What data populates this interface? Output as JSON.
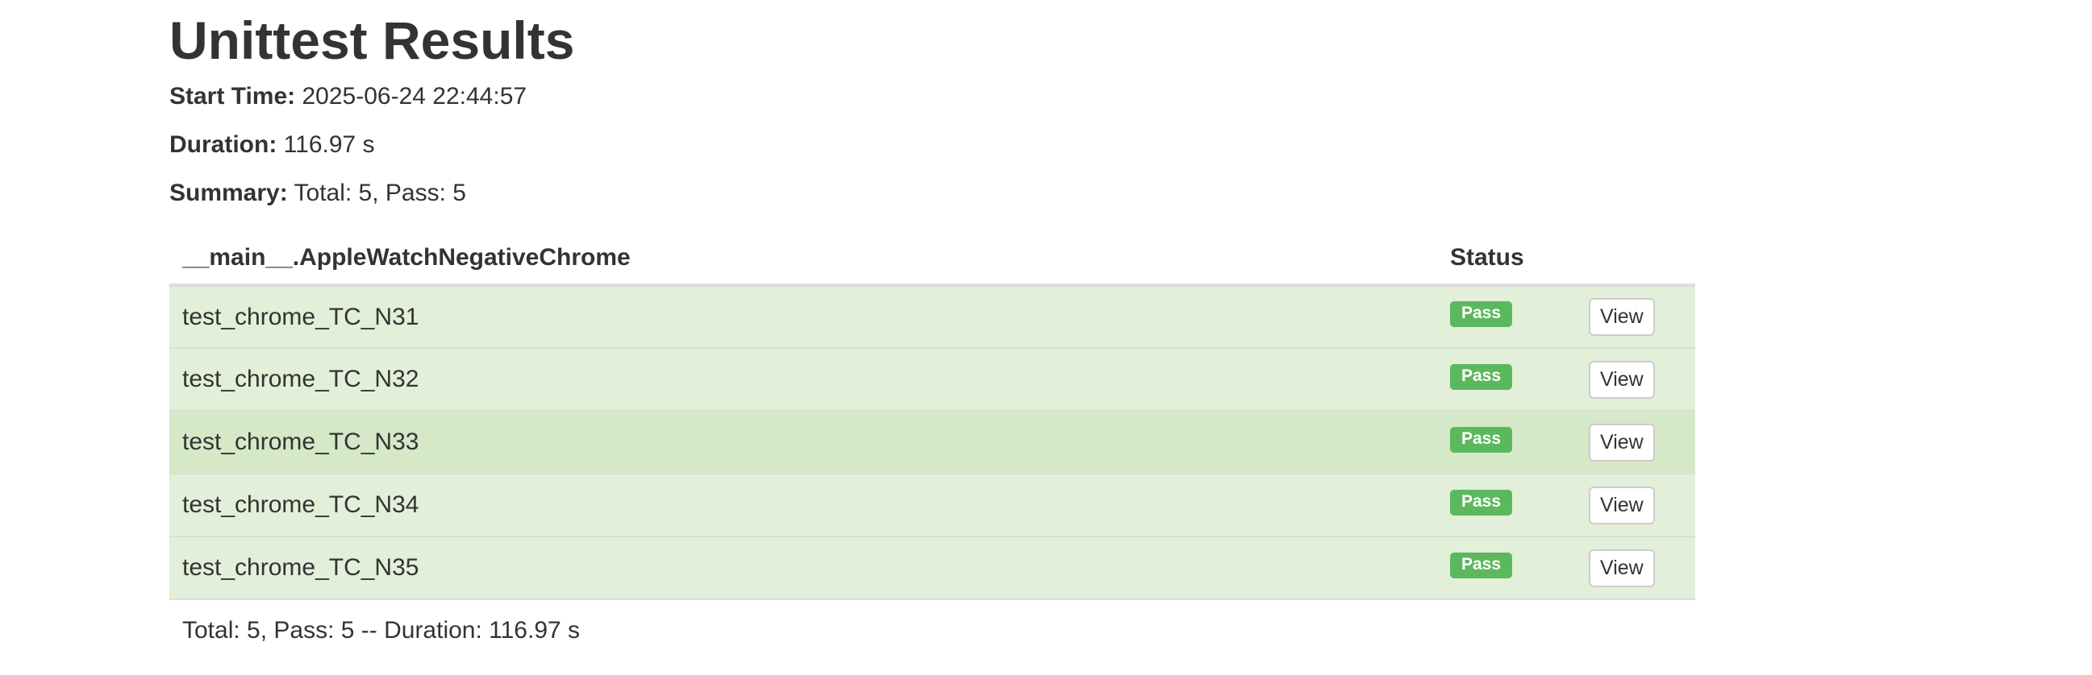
{
  "header": {
    "title": "Unittest Results",
    "start_time_label": "Start Time:",
    "start_time_value": "2025-06-24 22:44:57",
    "duration_label": "Duration:",
    "duration_value": "116.97 s",
    "summary_label": "Summary:",
    "summary_value": "Total: 5, Pass: 5"
  },
  "table": {
    "suite_name": "__main__.AppleWatchNegativeChrome",
    "status_header": "Status",
    "rows": [
      {
        "name": "test_chrome_TC_N31",
        "status": "Pass",
        "action": "View"
      },
      {
        "name": "test_chrome_TC_N32",
        "status": "Pass",
        "action": "View"
      },
      {
        "name": "test_chrome_TC_N33",
        "status": "Pass",
        "action": "View"
      },
      {
        "name": "test_chrome_TC_N34",
        "status": "Pass",
        "action": "View"
      },
      {
        "name": "test_chrome_TC_N35",
        "status": "Pass",
        "action": "View"
      }
    ],
    "footer": "Total: 5, Pass: 5 -- Duration: 116.97 s"
  },
  "colors": {
    "pass_badge": "#5cb85c",
    "row_background": "#e2efd9",
    "row_hover": "#d5e8c8"
  }
}
